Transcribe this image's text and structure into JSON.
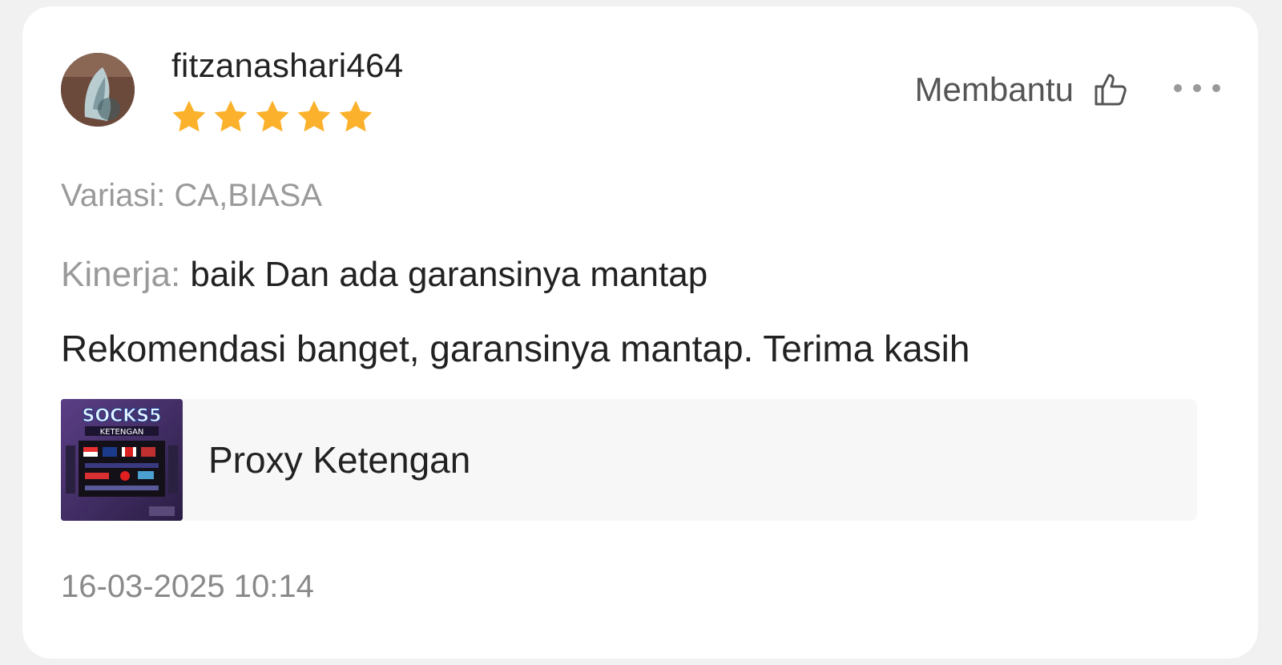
{
  "review": {
    "username": "fitzanashari464",
    "rating": 5,
    "rating_max": 5,
    "helpful_label": "Membantu",
    "variation": "Variasi: CA,BIASA",
    "performance_label": "Kinerja:",
    "performance_value": "baik Dan ada garansinya mantap",
    "comment": "Rekomendasi banget, garansinya mantap. Terima kasih",
    "product": {
      "name": "Proxy Ketengan",
      "thumb_title": "SOCKS5",
      "thumb_subtitle": "KETENGAN"
    },
    "timestamp": "16-03-2025 10:14"
  },
  "colors": {
    "star": "#fbb12b",
    "text_primary": "#222222",
    "text_muted": "#9a9a9a",
    "card_bg": "#ffffff",
    "page_bg": "#f1f1f1"
  },
  "icons": {
    "helpful": "thumbs-up-icon",
    "more": "more-dots-icon",
    "star": "star-icon"
  }
}
